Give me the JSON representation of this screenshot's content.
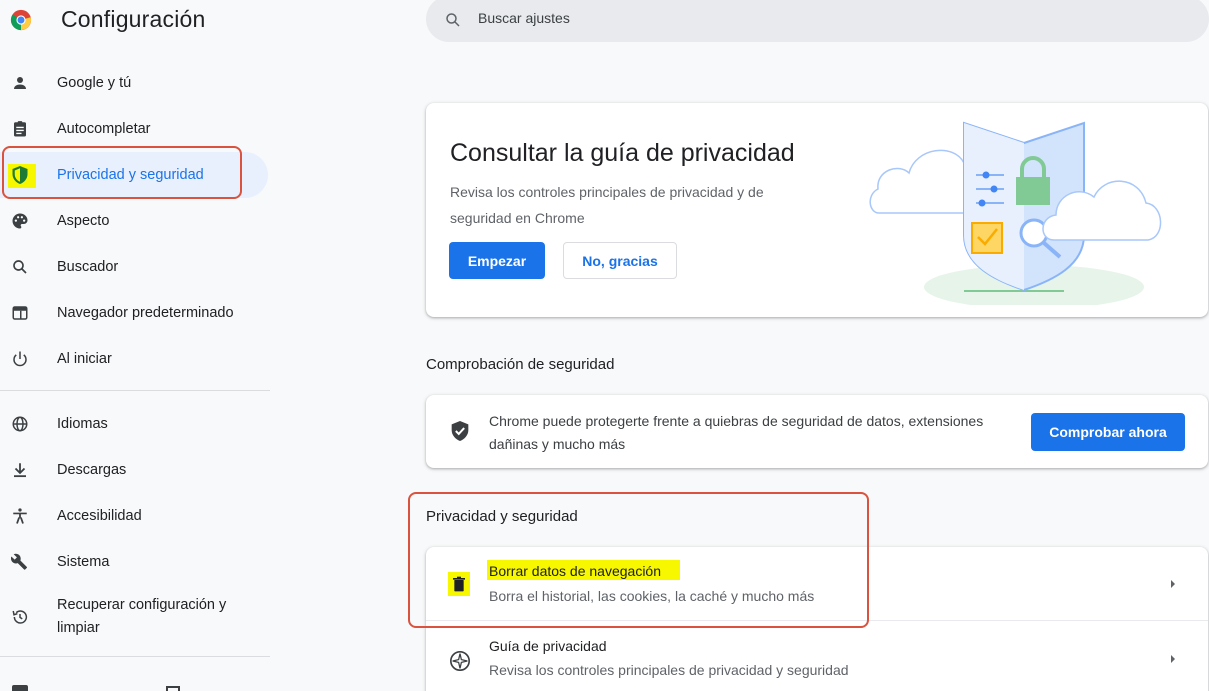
{
  "header": {
    "app_title": "Configuración",
    "search_placeholder": "Buscar ajustes"
  },
  "sidebar": {
    "items": [
      {
        "label": "Google y tú",
        "icon": "person-icon"
      },
      {
        "label": "Autocompletar",
        "icon": "clipboard-icon"
      },
      {
        "label": "Privacidad y seguridad",
        "icon": "shield-icon",
        "active": true
      },
      {
        "label": "Aspecto",
        "icon": "palette-icon"
      },
      {
        "label": "Buscador",
        "icon": "search-icon"
      },
      {
        "label": "Navegador predeterminado",
        "icon": "browser-icon"
      },
      {
        "label": "Al iniciar",
        "icon": "power-icon"
      },
      {
        "label": "Idiomas",
        "icon": "globe-icon"
      },
      {
        "label": "Descargas",
        "icon": "download-icon"
      },
      {
        "label": "Accesibilidad",
        "icon": "accessibility-icon"
      },
      {
        "label": "Sistema",
        "icon": "wrench-icon"
      },
      {
        "label": "Recuperar configuración y limpiar",
        "icon": "restore-icon"
      }
    ]
  },
  "promo": {
    "title": "Consultar la guía de privacidad",
    "description": "Revisa los controles principales de privacidad y de seguridad en Chrome",
    "start_label": "Empezar",
    "dismiss_label": "No, gracias"
  },
  "safety_check": {
    "section_title": "Comprobación de seguridad",
    "text": "Chrome puede protegerte frente a quiebras de seguridad de datos, extensiones dañinas y mucho más",
    "button_label": "Comprobar ahora"
  },
  "privacy": {
    "section_title": "Privacidad y seguridad",
    "rows": [
      {
        "title": "Borrar datos de navegación",
        "subtitle": "Borra el historial, las cookies, la caché y mucho más",
        "icon": "trash-icon"
      },
      {
        "title": "Guía de privacidad",
        "subtitle": "Revisa los controles principales de privacidad y seguridad",
        "icon": "compass-icon"
      }
    ]
  },
  "colors": {
    "accent": "#1a73e8",
    "highlight": "#f7f700",
    "annotation": "#d9533f"
  }
}
